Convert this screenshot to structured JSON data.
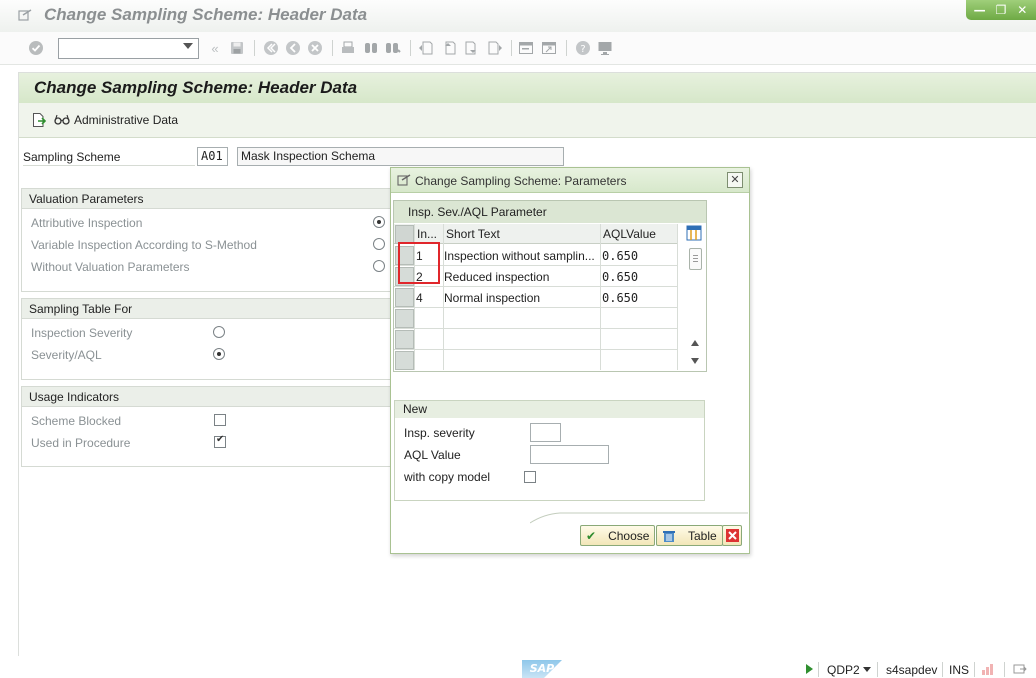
{
  "window": {
    "title": "Change Sampling Scheme: Header Data",
    "controls": [
      "minimize-icon",
      "maximize-icon",
      "close-icon"
    ]
  },
  "toolbar": {
    "command_field_value": "",
    "icons": [
      "enter-icon",
      "back-icon",
      "save-icon",
      "first-page-icon",
      "previous-page-icon",
      "cancel-icon",
      "print-icon",
      "find-icon",
      "find-next-icon",
      "page-first-icon",
      "page-previous-icon",
      "page-next-icon",
      "page-last-icon",
      "create-session-icon",
      "shortcut-icon",
      "help-icon",
      "layout-icon"
    ]
  },
  "screen": {
    "title": "Change Sampling Scheme: Header Data",
    "app_toolbar": {
      "admin_data_label": "Administrative Data"
    },
    "sampling_scheme": {
      "label": "Sampling Scheme",
      "code": "A01",
      "description": "Mask Inspection Schema"
    },
    "valuation_parameters": {
      "title": "Valuation Parameters",
      "options": [
        {
          "label": "Attributive Inspection",
          "selected": true
        },
        {
          "label": "Variable Inspection According to S-Method",
          "selected": false
        },
        {
          "label": "Without Valuation Parameters",
          "selected": false
        }
      ]
    },
    "sampling_table_for": {
      "title": "Sampling Table For",
      "options": [
        {
          "label": "Inspection Severity",
          "selected": false
        },
        {
          "label": "Severity/AQL",
          "selected": true
        }
      ]
    },
    "usage_indicators": {
      "title": "Usage Indicators",
      "items": [
        {
          "label": "Scheme Blocked",
          "checked": false
        },
        {
          "label": "Used in Procedure",
          "checked": true
        }
      ]
    }
  },
  "dialog": {
    "title": "Change Sampling Scheme: Parameters",
    "table": {
      "title": "Insp. Sev./AQL Parameter",
      "columns": [
        "In...",
        "Short Text",
        "AQLValue"
      ],
      "rows": [
        {
          "severity": "1",
          "short_text": "Inspection without samplin...",
          "aql": "0.650"
        },
        {
          "severity": "2",
          "short_text": "Reduced inspection",
          "aql": "0.650"
        },
        {
          "severity": "4",
          "short_text": "Normal inspection",
          "aql": "0.650"
        }
      ]
    },
    "new_group": {
      "title": "New",
      "insp_severity_label": "Insp. severity",
      "insp_severity_value": "",
      "aql_value_label": "AQL Value",
      "aql_value_value": "",
      "copy_model_label": "with copy model",
      "copy_model_checked": false
    },
    "buttons": {
      "choose": "Choose",
      "table": "Table"
    }
  },
  "status_bar": {
    "logo": "SAP",
    "system": "QDP2",
    "server": "s4sapdev",
    "mode": "INS"
  },
  "colors": {
    "header_green": "#d6e7c9",
    "window_controls_green": "#6ea944",
    "highlight_red": "#e0262b",
    "button_yellow": "#f2e6b8"
  }
}
